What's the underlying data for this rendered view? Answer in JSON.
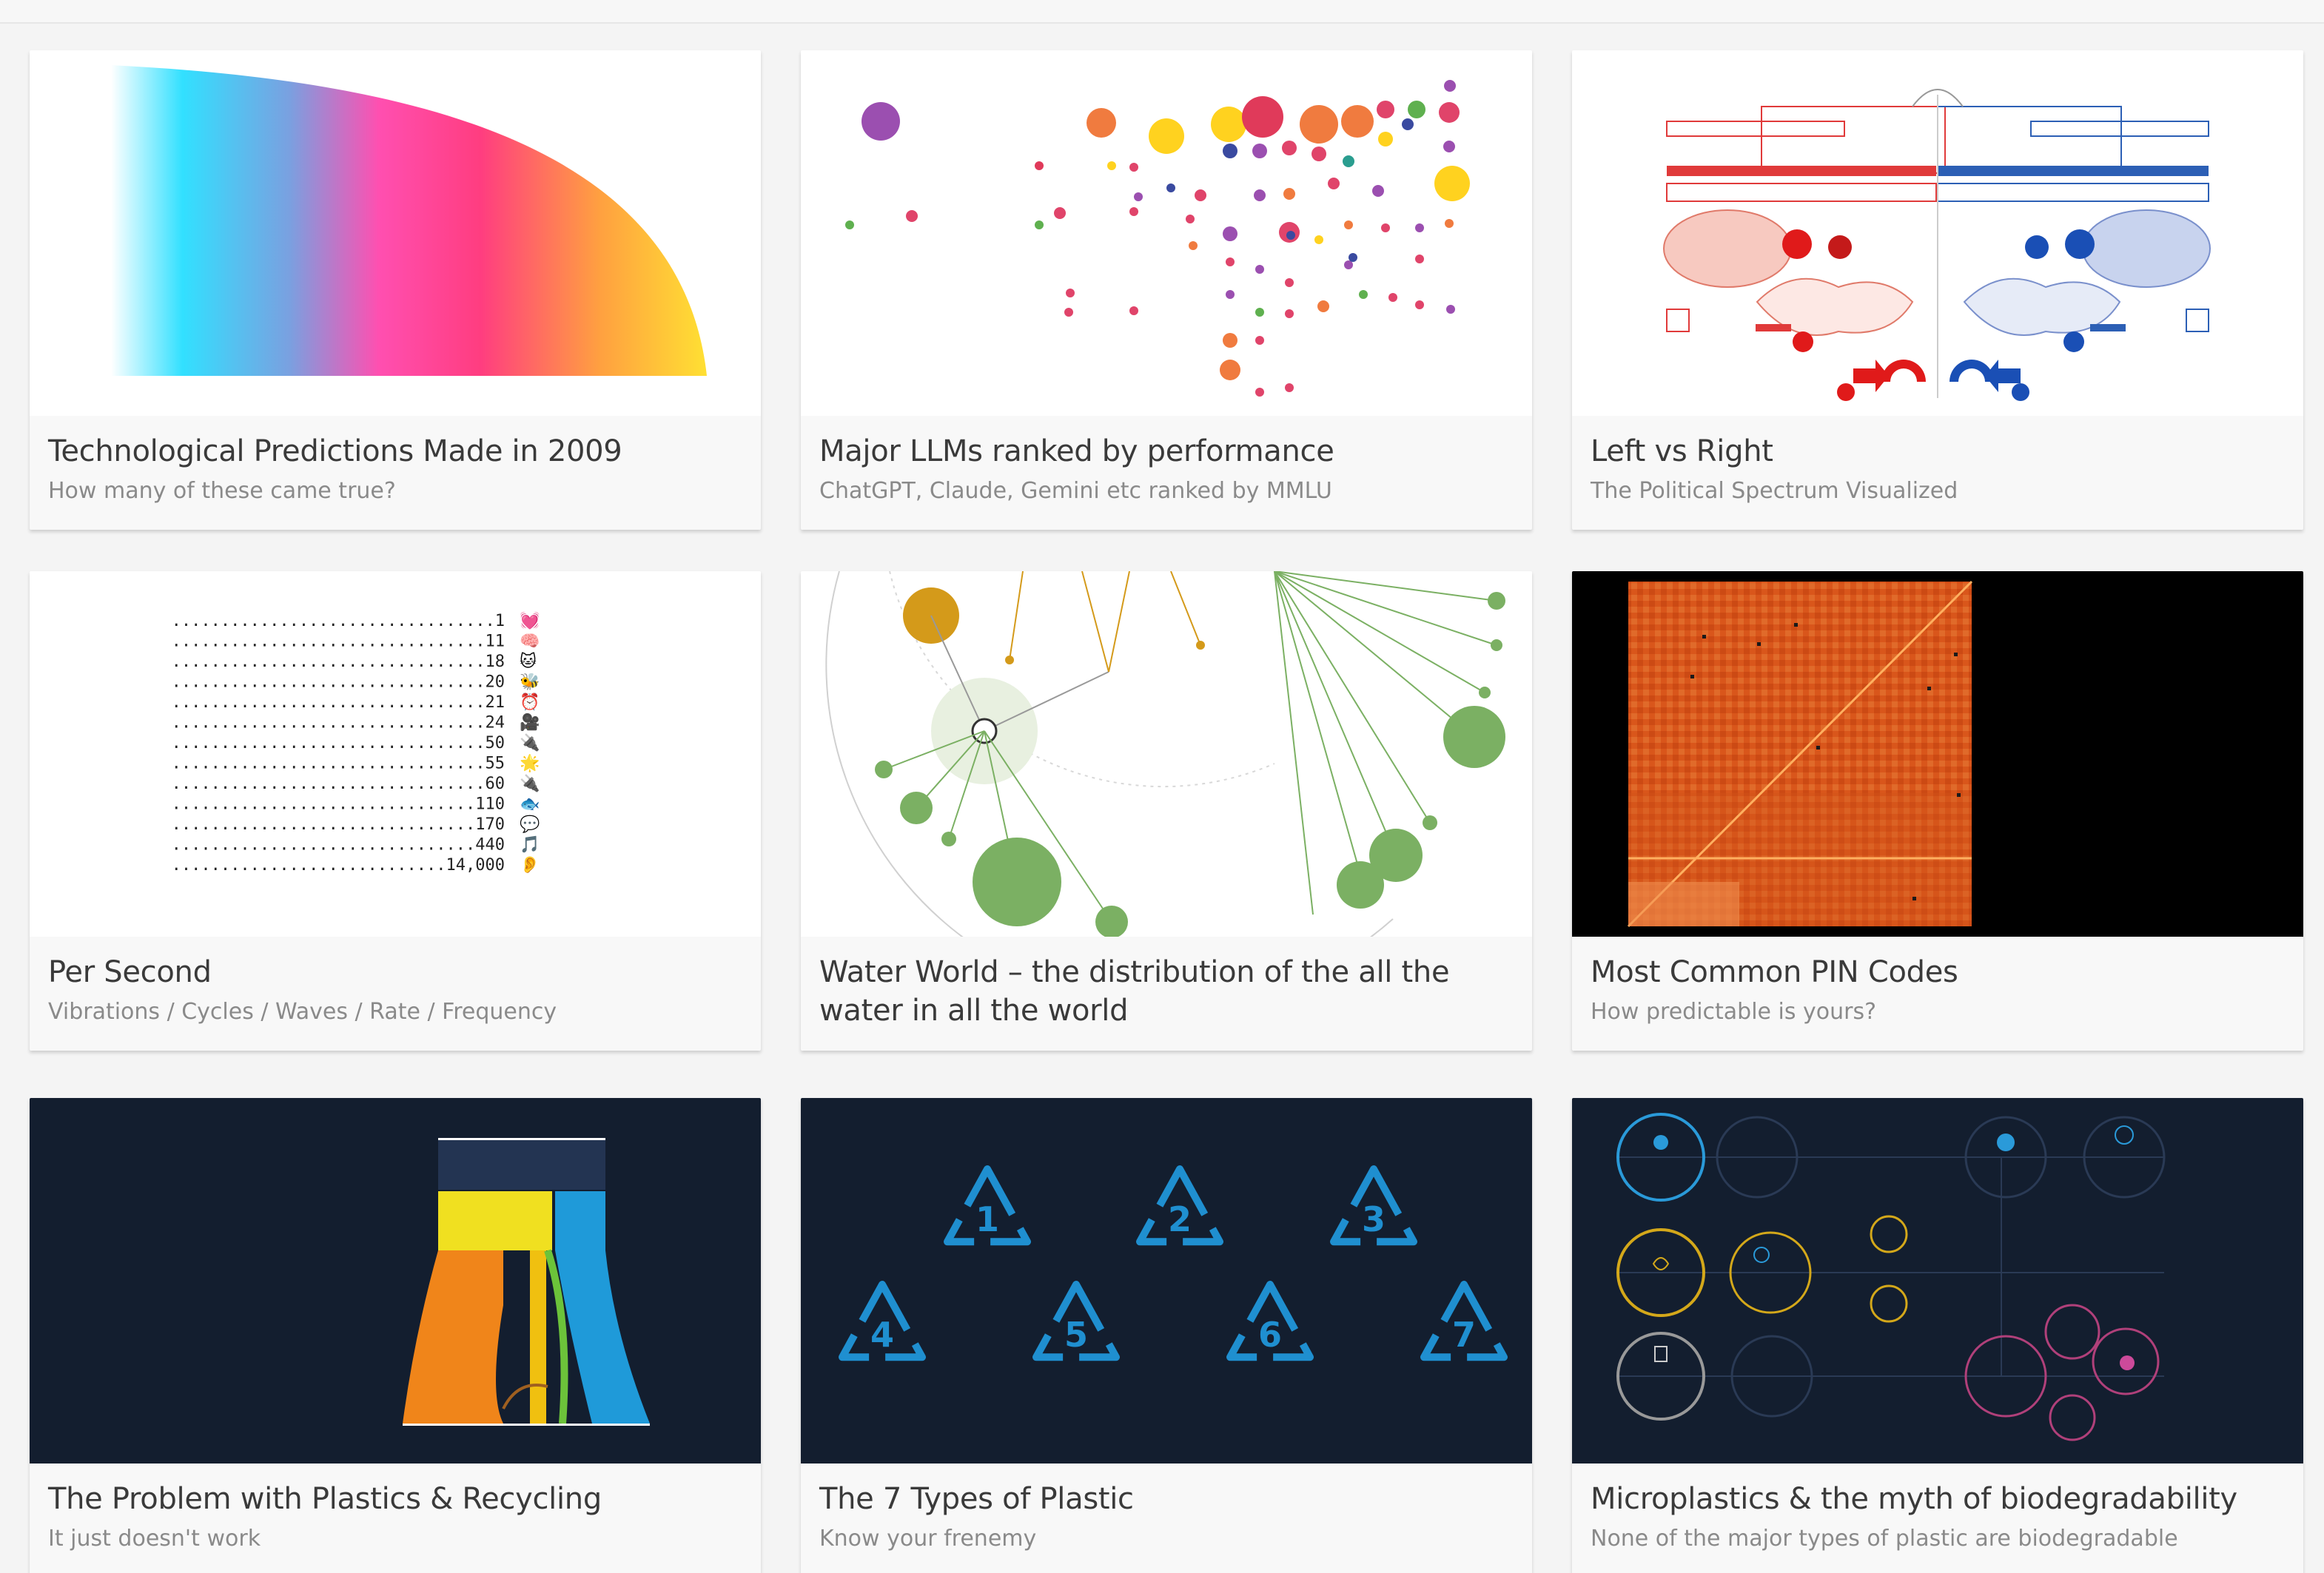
{
  "cards": [
    {
      "title": "Technological Predictions Made in 2009",
      "subtitle": "How many of these came true?"
    },
    {
      "title": "Major LLMs ranked by performance",
      "subtitle": "ChatGPT, Claude, Gemini etc ranked by MMLU"
    },
    {
      "title": "Left vs Right",
      "subtitle": "The Political Spectrum Visualized"
    },
    {
      "title": "Per Second",
      "subtitle": "Vibrations / Cycles / Waves / Rate / Frequency"
    },
    {
      "title": "Water World – the distribution of the all the water in all the world",
      "subtitle": ""
    },
    {
      "title": "Most Common PIN Codes",
      "subtitle": "How predictable is yours?"
    },
    {
      "title": "The Problem with Plastics & Recycling",
      "subtitle": "It just doesn't work"
    },
    {
      "title": "The 7 Types of Plastic",
      "subtitle": "Know your frenemy"
    },
    {
      "title": "Microplastics & the myth of biodegradability",
      "subtitle": "None of the major types of plastic are biodegradable"
    }
  ],
  "per_second": {
    "values": [
      "1",
      "11",
      "18",
      "20",
      "21",
      "24",
      "50",
      "55",
      "60",
      "110",
      "170",
      "440",
      "14,000"
    ],
    "icons": [
      "💓",
      "🧠",
      "🐱",
      "🐝",
      "⏰",
      "🎥",
      "🔌",
      "🌟",
      "🔌",
      "🐟",
      "💬",
      "🎵",
      "👂"
    ]
  },
  "plastic_numbers": [
    "1",
    "2",
    "3",
    "4",
    "5",
    "6",
    "7"
  ],
  "colors": {
    "navy": "#131e2f",
    "recycle_blue": "#1f8fd0",
    "pin_orange": "#d9561b",
    "text_title": "#3a3a3a",
    "text_sub": "#8a8a8a"
  }
}
